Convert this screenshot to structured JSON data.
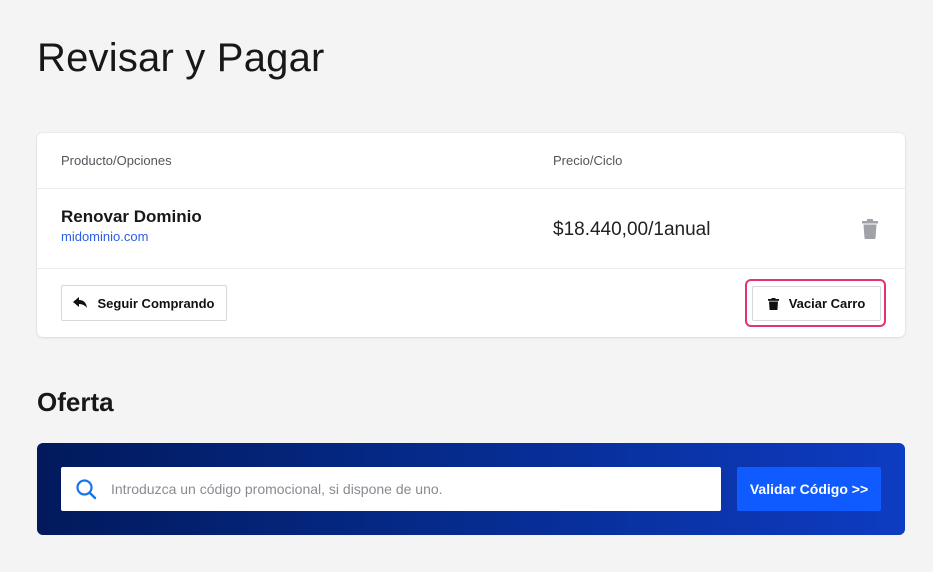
{
  "page": {
    "title": "Revisar y Pagar"
  },
  "cart": {
    "columns": {
      "product": "Producto/Opciones",
      "price": "Precio/Ciclo"
    },
    "items": [
      {
        "name": "Renovar Dominio",
        "domain": "midominio.com",
        "price": "$18.440,00/1anual"
      }
    ],
    "continue_label": "Seguir Comprando",
    "empty_label": "Vaciar Carro"
  },
  "offer": {
    "title": "Oferta",
    "promo_placeholder": "Introduzca un código promocional, si dispone de uno.",
    "validate_label": "Validar Código >>"
  },
  "colors": {
    "accent": "#0f5bff",
    "link": "#2d5fe0",
    "highlight": "#e3327a",
    "band_start": "#021a5c",
    "band_end": "#0e3cc2"
  },
  "icons": {
    "item_remove": "trash-icon",
    "continue": "reply-arrow-icon",
    "empty": "trash-icon",
    "search": "search-icon"
  }
}
